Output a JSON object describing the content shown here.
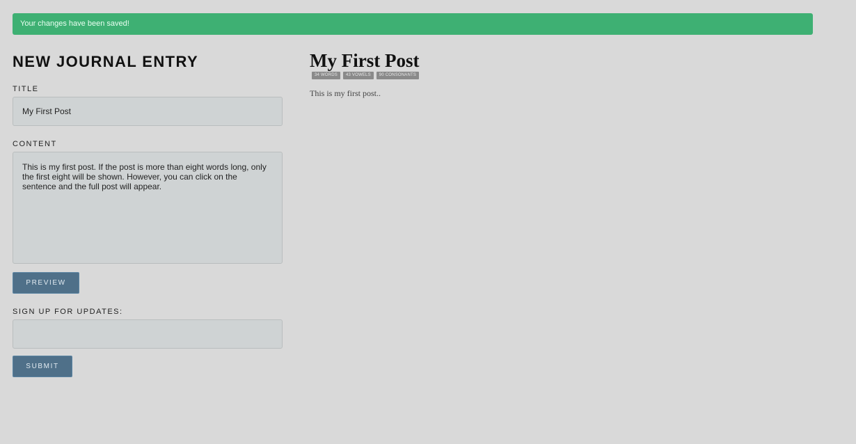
{
  "alert": {
    "text": "Your changes have been saved!",
    "color": "#3eb073"
  },
  "form": {
    "heading": "NEW JOURNAL ENTRY",
    "title_label": "TITLE",
    "title_value": "My First Post",
    "content_label": "CONTENT",
    "content_value": "This is my first post. If the post is more than eight words long, only the first eight will be shown. However, you can click on the sentence and the full post will appear.",
    "preview_button": "PREVIEW",
    "signup_label": "SIGN UP FOR UPDATES:",
    "signup_value": "",
    "submit_button": "SUBMIT"
  },
  "preview": {
    "title": "My First Post",
    "badges": {
      "words": "34 WORDS",
      "vowels": "43 VOWELS",
      "consonants": "90 CONSONANTS"
    },
    "body": "This is my first post.."
  },
  "colors": {
    "button": "#4f7089",
    "background": "#d9d9d9",
    "badge": "#8a8a8a"
  }
}
